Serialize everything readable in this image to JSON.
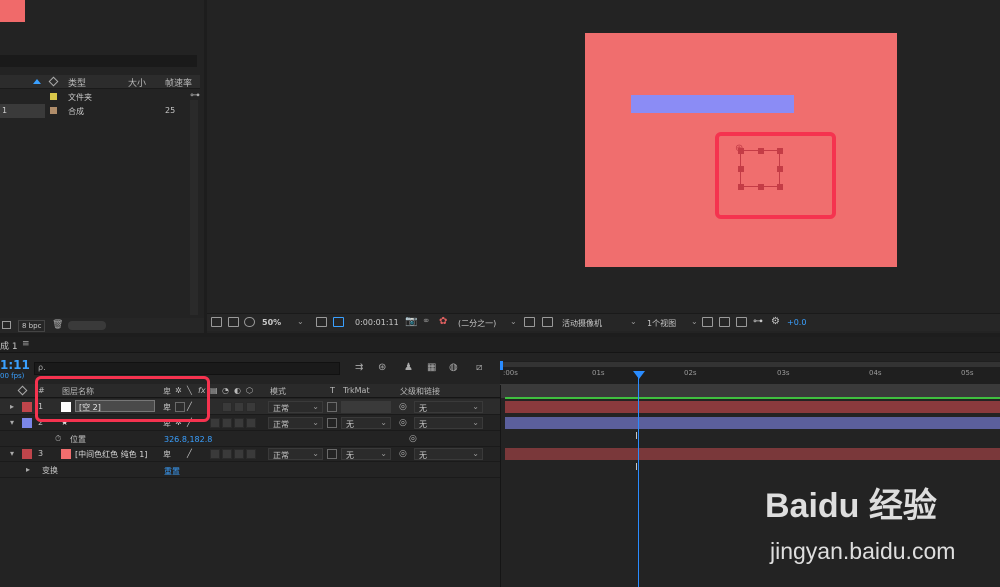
{
  "project": {
    "columns": [
      "类型",
      "大小",
      "帧速率"
    ],
    "items": [
      {
        "num": "",
        "type": "文件夹",
        "fps": "",
        "color": "#d9c84a"
      },
      {
        "num": "1",
        "type": "合成",
        "fps": "25",
        "color": "#b08d6a"
      }
    ],
    "bpc": "8 bpc"
  },
  "viewer": {
    "zoom": "50%",
    "timecode": "0:00:01:11",
    "resolution": "(二分之一)",
    "camera": "活动摄像机",
    "views": "1个视图",
    "exposure": "+0.0"
  },
  "timeline": {
    "tab": "成 1",
    "timecode": "1:11",
    "fps": "00 fps)",
    "search_placeholder": "ρ.",
    "columns": {
      "layer_name": "图层名称",
      "mode": "模式",
      "t": "T",
      "trkmat": "TrkMat",
      "parent": "父级和链接"
    },
    "layers": [
      {
        "num": "1",
        "name": "[空 2]",
        "mode": "正常",
        "trkmat": "",
        "parent": "无",
        "label_color": "#c0454b",
        "bar_color": "#8a3a3d"
      },
      {
        "num": "2",
        "name": "★",
        "mode": "正常",
        "trkmat": "无",
        "parent": "无",
        "label_color": "#7b86e8",
        "bar_color": "#5b5f9c"
      },
      {
        "num": "3",
        "name": "[中间色红色 纯色 1]",
        "mode": "正常",
        "trkmat": "无",
        "parent": "无",
        "label_color": "#c0454b",
        "bar_color": "#7a383a"
      }
    ],
    "position_label": "位置",
    "position_value": "326.8,182.8",
    "transform_label": "变换",
    "reset_label": "重置",
    "ruler_ticks": [
      ":00s",
      "01s",
      "02s",
      "03s",
      "04s",
      "05s"
    ]
  },
  "watermark": {
    "brand": "Baidu 经验",
    "url": "jingyan.baidu.com"
  }
}
